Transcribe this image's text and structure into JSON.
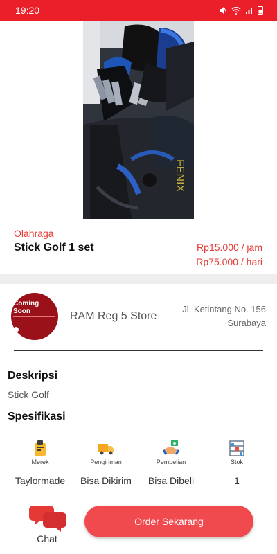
{
  "status_bar": {
    "time": "19:20",
    "icons": [
      "mute-icon",
      "wifi-icon",
      "signal-icon",
      "battery-icon"
    ]
  },
  "product": {
    "category": "Olahraga",
    "title": "Stick Golf 1 set",
    "price_hour": "Rp15.000 / jam",
    "price_day": "Rp75.000 / hari"
  },
  "store": {
    "logo_text": "Coming Soon",
    "name": "RAM Reg 5 Store",
    "address_line1": "Jl. Ketintang No. 156",
    "address_line2": "Surabaya"
  },
  "description": {
    "title": "Deskripsi",
    "text": "Stick Golf"
  },
  "specifications": {
    "title": "Spesifikasi",
    "items": [
      {
        "label": "Merek",
        "value": "Taylormade",
        "icon": "brand-tag-icon"
      },
      {
        "label": "Pengiriman",
        "value": "Bisa Dikirim",
        "icon": "delivery-truck-icon"
      },
      {
        "label": "Pembelian",
        "value": "Bisa Dibeli",
        "icon": "purchase-handshake-icon"
      },
      {
        "label": "Stok",
        "value": "1",
        "icon": "stock-shelf-icon"
      }
    ]
  },
  "actions": {
    "chat_label": "Chat",
    "order_label": "Order Sekarang"
  },
  "colors": {
    "accent": "#ea1f2a",
    "price": "#e53935",
    "button": "#f04a4f",
    "logo_bg": "#9b111a"
  }
}
